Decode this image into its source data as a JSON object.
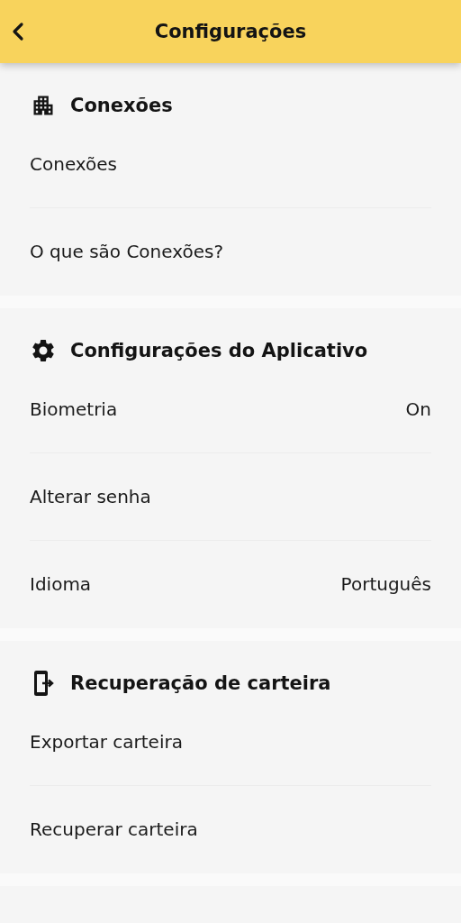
{
  "header": {
    "title": "Configurações"
  },
  "sections": [
    {
      "title": "Conexões",
      "items": [
        {
          "label": "Conexões"
        },
        {
          "label": "O que são Conexões?"
        }
      ]
    },
    {
      "title": "Configurações do Aplicativo",
      "items": [
        {
          "label": "Biometria",
          "value": "On"
        },
        {
          "label": "Alterar senha"
        },
        {
          "label": "Idioma",
          "value": "Português"
        }
      ]
    },
    {
      "title": "Recuperação de carteira",
      "items": [
        {
          "label": "Exportar carteira"
        },
        {
          "label": "Recuperar carteira"
        }
      ]
    }
  ]
}
